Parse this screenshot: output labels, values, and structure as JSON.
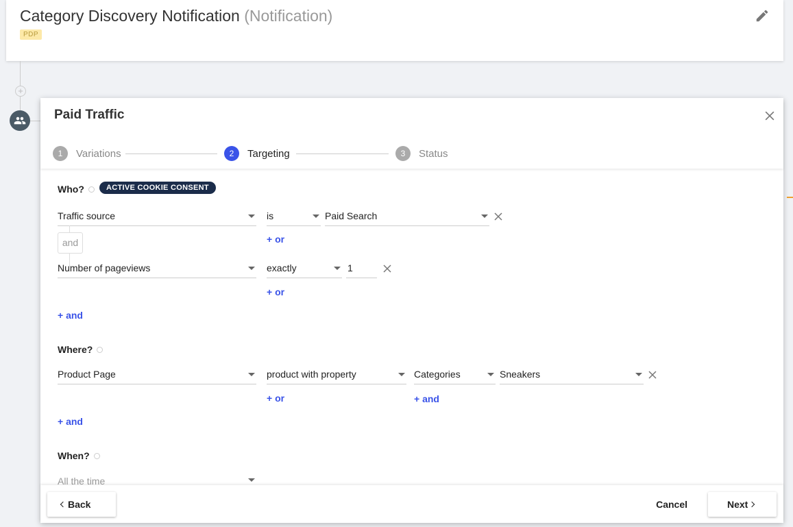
{
  "header": {
    "title": "Category Discovery Notification",
    "subtitle": "(Notification)",
    "badge": "PDP",
    "edit_icon": "pencil-icon"
  },
  "timeline": {
    "add_icon": "plus-circle-icon",
    "plus_glyph": "+",
    "audience_icon": "people-icon"
  },
  "modal": {
    "title": "Paid Traffic",
    "close_icon": "close-icon",
    "steps": [
      {
        "number": "1",
        "label": "Variations",
        "active": false
      },
      {
        "number": "2",
        "label": "Targeting",
        "active": true
      },
      {
        "number": "3",
        "label": "Status",
        "active": false
      }
    ],
    "who": {
      "title": "Who?",
      "consent_badge": "ACTIVE COOKIE CONSENT",
      "conditions": [
        {
          "field": "Traffic source",
          "operator": "is",
          "value": "Paid Search",
          "or_label": "+ or"
        },
        {
          "field": "Number of pageviews",
          "operator": "exactly",
          "value": "1",
          "or_label": "+ or"
        }
      ],
      "and_connector": "and",
      "add_and": "+ and"
    },
    "where": {
      "title": "Where?",
      "page": "Product Page",
      "operator": "product with property",
      "property": "Categories",
      "value": "Sneakers",
      "or_label": "+ or",
      "inner_and_label": "+ and",
      "add_and": "+ and"
    },
    "when": {
      "title": "When?",
      "value": "All the time"
    },
    "footer": {
      "back_label": "Back",
      "cancel_label": "Cancel",
      "next_label": "Next"
    }
  },
  "colors": {
    "accent": "#3a53e8",
    "badge_dark": "#1b2c4a",
    "pdp_badge_bg": "#fde9a8"
  }
}
